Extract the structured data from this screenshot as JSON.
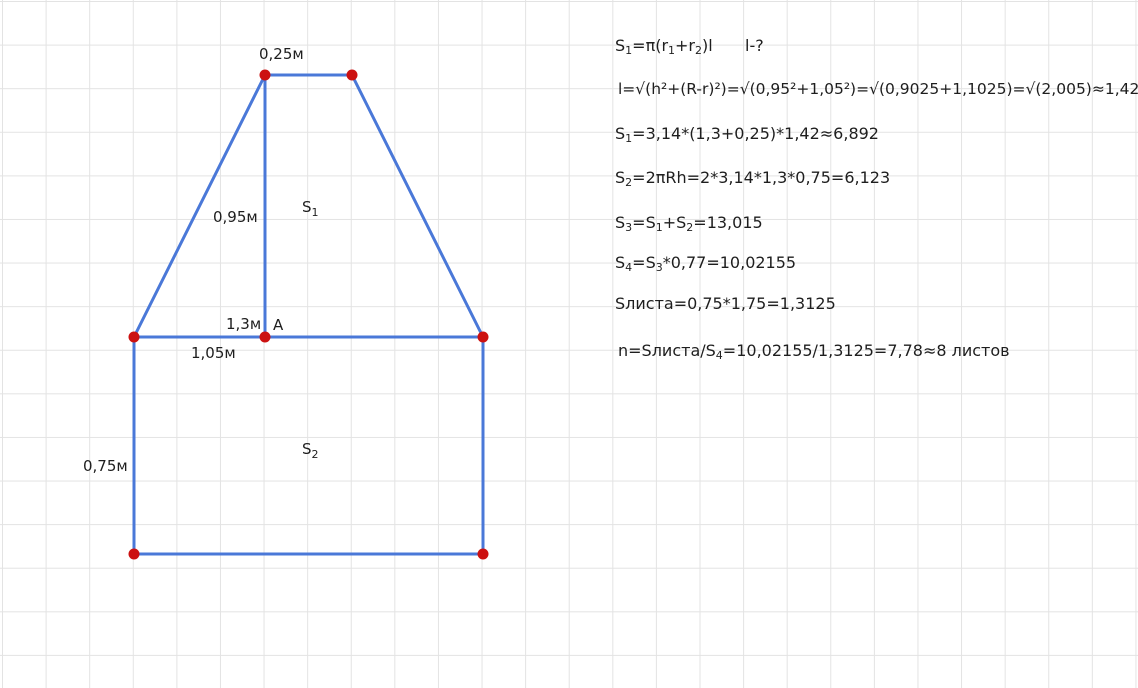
{
  "diagram": {
    "labels": {
      "top_width": "0,25м",
      "height_cone": "0,95м",
      "s1_main": "S",
      "s1_sub": "1",
      "r_big": "1,3м",
      "point_a": "A",
      "slant_base": "1,05м",
      "s2_main": "S",
      "s2_sub": "2",
      "cyl_height": "0,75м"
    },
    "colors": {
      "line": "#4a78d8",
      "point": "#cc1111",
      "grid": "#e3e3e3"
    }
  },
  "formulas": {
    "f1": {
      "a": "S",
      "a_sub": "1",
      "b": "=π(r",
      "b_sub": "1",
      "c": "+r",
      "c_sub": "2",
      "d": ")l",
      "e": "l-?"
    },
    "f2": {
      "text": "l=√(h²+(R-r)²)=√(0,95²+1,05²)=√(0,9025+1,1025)=√(2,005)≈1,42"
    },
    "f3": {
      "a": "S",
      "a_sub": "1",
      "b": "=3,14*(1,3+0,25)*1,42≈6,892"
    },
    "f4": {
      "a": "S",
      "a_sub": "2",
      "b": "=2πRh=2*3,14*1,3*0,75=6,123"
    },
    "f5": {
      "a": "S",
      "a_sub": "3",
      "b": "=S",
      "b_sub": "1",
      "c": "+S",
      "c_sub": "2",
      "d": "=13,015"
    },
    "f6": {
      "a": "S",
      "a_sub": "4",
      "b": "=S",
      "b_sub": "3",
      "c": "*0,77=10,02155"
    },
    "f7": {
      "text": "Sлиста=0,75*1,75=1,3125"
    },
    "f8": {
      "a": "n=Sлиста/S",
      "a_sub": "4",
      "b": "=10,02155/1,3125=7,78≈8 листов"
    }
  }
}
